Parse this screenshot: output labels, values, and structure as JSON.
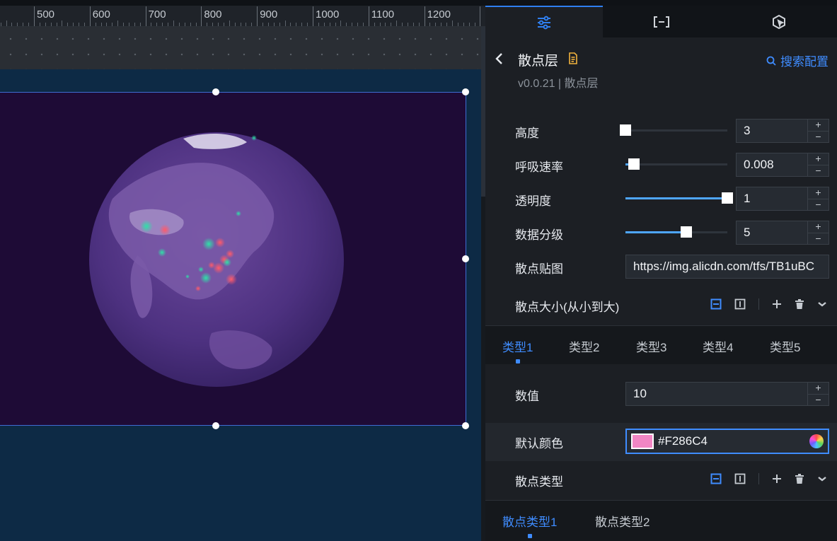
{
  "ruler": {
    "labels": [
      "500",
      "600",
      "700",
      "800",
      "900",
      "1000",
      "1100",
      "1200"
    ]
  },
  "panel": {
    "tabs": [
      {
        "icon": "sliders-icon",
        "active": true
      },
      {
        "icon": "bracket-icon",
        "active": false
      },
      {
        "icon": "hexagon-cursor-icon",
        "active": false
      }
    ],
    "header": {
      "title": "散点层",
      "version": "v0.0.21 | 散点层",
      "search_label": "搜索配置"
    },
    "settings": {
      "height": {
        "label": "高度",
        "value": "3",
        "level": 0.0
      },
      "breath_speed": {
        "label": "呼吸速率",
        "value": "0.008",
        "level": 0.08
      },
      "opacity": {
        "label": "透明度",
        "value": "1",
        "level": 1.0
      },
      "data_grade": {
        "label": "数据分级",
        "value": "5",
        "level": 0.6
      },
      "texture": {
        "label": "散点贴图",
        "value": "https://img.alicdn.com/tfs/TB1uBC"
      },
      "size_group": {
        "label": "散点大小(从小到大)"
      }
    },
    "type_tabs": [
      "类型1",
      "类型2",
      "类型3",
      "类型4",
      "类型5"
    ],
    "type_settings": {
      "value": {
        "label": "数值",
        "value": "10"
      },
      "default_color": {
        "label": "默认颜色",
        "value": "#F286C4",
        "swatch": "#F286C4"
      },
      "scatter_type": {
        "label": "散点类型"
      }
    },
    "scatter_type_tabs": [
      "散点类型1",
      "散点类型2"
    ]
  },
  "colors": {
    "accent": "#3f8cff",
    "frame_bg": "#1e0b36",
    "canvas_bg": "#0d2a45"
  }
}
